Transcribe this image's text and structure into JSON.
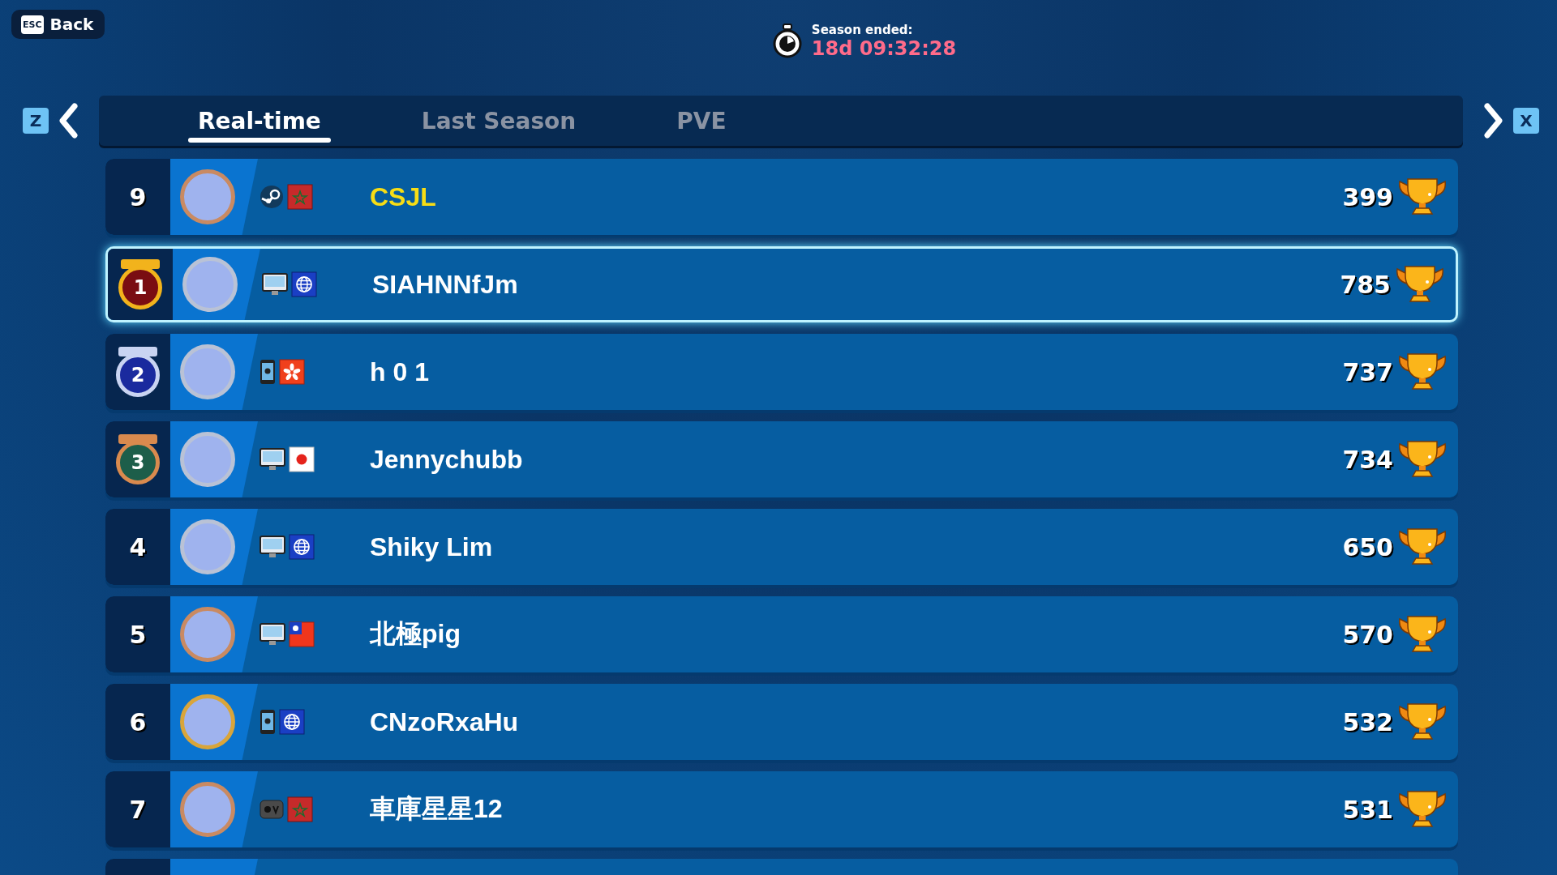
{
  "back": {
    "key": "ESC",
    "label": "Back"
  },
  "timer": {
    "label": "Season ended:",
    "value": "18d 09:32:28"
  },
  "nav": {
    "prev_key": "Z",
    "next_key": "X"
  },
  "tabs": [
    {
      "label": "Real-time",
      "selected": true
    },
    {
      "label": "Last Season",
      "selected": false
    },
    {
      "label": "PVE",
      "selected": false
    }
  ],
  "rows": [
    {
      "rank": "9",
      "avatar": {
        "kind": "bronze"
      },
      "platform": {
        "kind": "steam"
      },
      "flag": {
        "kind": "morocco"
      },
      "name": "CSJL",
      "is_self": true,
      "selected": false,
      "score": "399"
    },
    {
      "rank": "1",
      "medal": {
        "kind": "gold"
      },
      "avatar": {
        "kind": "silver"
      },
      "platform": {
        "kind": "pc"
      },
      "flag": {
        "kind": "global"
      },
      "name": "SIAHNNfJm",
      "is_self": false,
      "selected": true,
      "score": "785"
    },
    {
      "rank": "2",
      "medal": {
        "kind": "silver"
      },
      "avatar": {
        "kind": "silver"
      },
      "platform": {
        "kind": "mobile"
      },
      "flag": {
        "kind": "hong-kong"
      },
      "name": "h 0 1",
      "is_self": false,
      "selected": false,
      "score": "737"
    },
    {
      "rank": "3",
      "medal": {
        "kind": "bronze"
      },
      "avatar": {
        "kind": "silver"
      },
      "platform": {
        "kind": "pc"
      },
      "flag": {
        "kind": "japan"
      },
      "name": "Jennychubb",
      "is_self": false,
      "selected": false,
      "score": "734"
    },
    {
      "rank": "4",
      "avatar": {
        "kind": "silver"
      },
      "platform": {
        "kind": "pc"
      },
      "flag": {
        "kind": "global"
      },
      "name": "Shiky Lim",
      "is_self": false,
      "selected": false,
      "score": "650"
    },
    {
      "rank": "5",
      "avatar": {
        "kind": "bronze"
      },
      "platform": {
        "kind": "pc"
      },
      "flag": {
        "kind": "taiwan"
      },
      "name": "北極pig",
      "is_self": false,
      "selected": false,
      "score": "570"
    },
    {
      "rank": "6",
      "avatar": {
        "kind": "gold"
      },
      "platform": {
        "kind": "mobile"
      },
      "flag": {
        "kind": "global"
      },
      "name": "CNzoRxaHu",
      "is_self": false,
      "selected": false,
      "score": "532"
    },
    {
      "rank": "7",
      "avatar": {
        "kind": "bronze"
      },
      "platform": {
        "kind": "tv"
      },
      "flag": {
        "kind": "morocco"
      },
      "name": "車庫星星12",
      "is_self": false,
      "selected": false,
      "score": "531"
    }
  ]
}
